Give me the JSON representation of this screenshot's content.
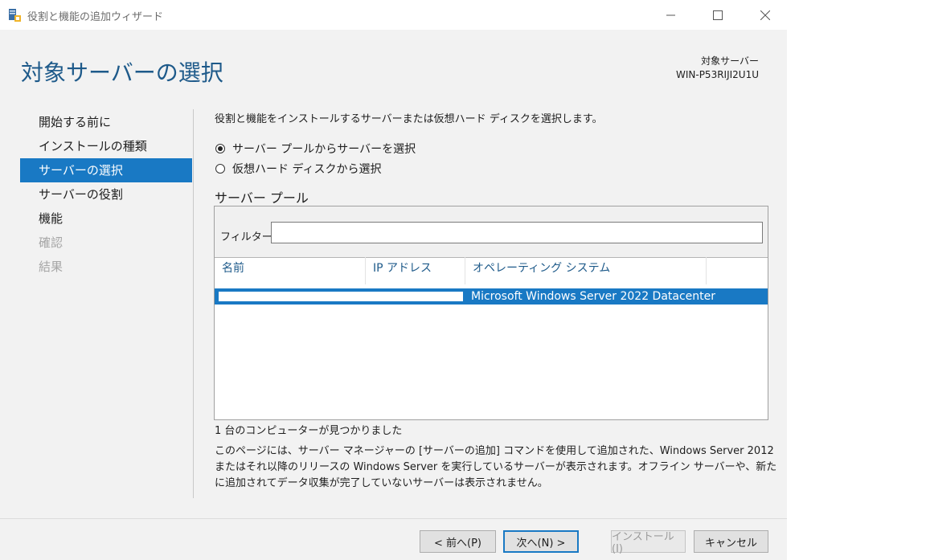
{
  "window": {
    "title": "役割と機能の追加ウィザード",
    "icon": "server-manager-icon"
  },
  "header": {
    "page_title": "対象サーバーの選択",
    "destination_label": "対象サーバー",
    "destination_name": "WIN-P53RIJI2U1U"
  },
  "nav": {
    "items": [
      {
        "label": "開始する前に",
        "state": "normal"
      },
      {
        "label": "インストールの種類",
        "state": "normal"
      },
      {
        "label": "サーバーの選択",
        "state": "active"
      },
      {
        "label": "サーバーの役割",
        "state": "normal"
      },
      {
        "label": "機能",
        "state": "normal"
      },
      {
        "label": "確認",
        "state": "disabled"
      },
      {
        "label": "結果",
        "state": "disabled"
      }
    ]
  },
  "main": {
    "instruction": "役割と機能をインストールするサーバーまたは仮想ハード ディスクを選択します。",
    "options": [
      {
        "label": "サーバー プールからサーバーを選択",
        "checked": true
      },
      {
        "label": "仮想ハード ディスクから選択",
        "checked": false
      }
    ],
    "pool_title": "サーバー プール",
    "filter_label": "フィルター:",
    "filter_value": "",
    "columns": [
      "名前",
      "IP アドレス",
      "オペレーティング システム"
    ],
    "rows": [
      {
        "name": "",
        "ip": "",
        "os": "Microsoft Windows Server 2022 Datacenter",
        "selected": true
      }
    ],
    "found_text": "1 台のコンピューターが見つかりました",
    "note": "このページには、サーバー マネージャーの [サーバーの追加] コマンドを使用して追加された、Windows Server 2012 またはそれ以降のリリースの Windows Server を実行しているサーバーが表示されます。オフライン サーバーや、新たに追加されてデータ収集が完了していないサーバーは表示されません。"
  },
  "footer": {
    "prev_label": "< 前へ(P)",
    "next_label": "次へ(N) >",
    "install_label": "インストール(I)",
    "cancel_label": "キャンセル"
  },
  "colors": {
    "accent": "#1979c4",
    "heading": "#1e5a8a",
    "background": "#f2f2f2"
  }
}
